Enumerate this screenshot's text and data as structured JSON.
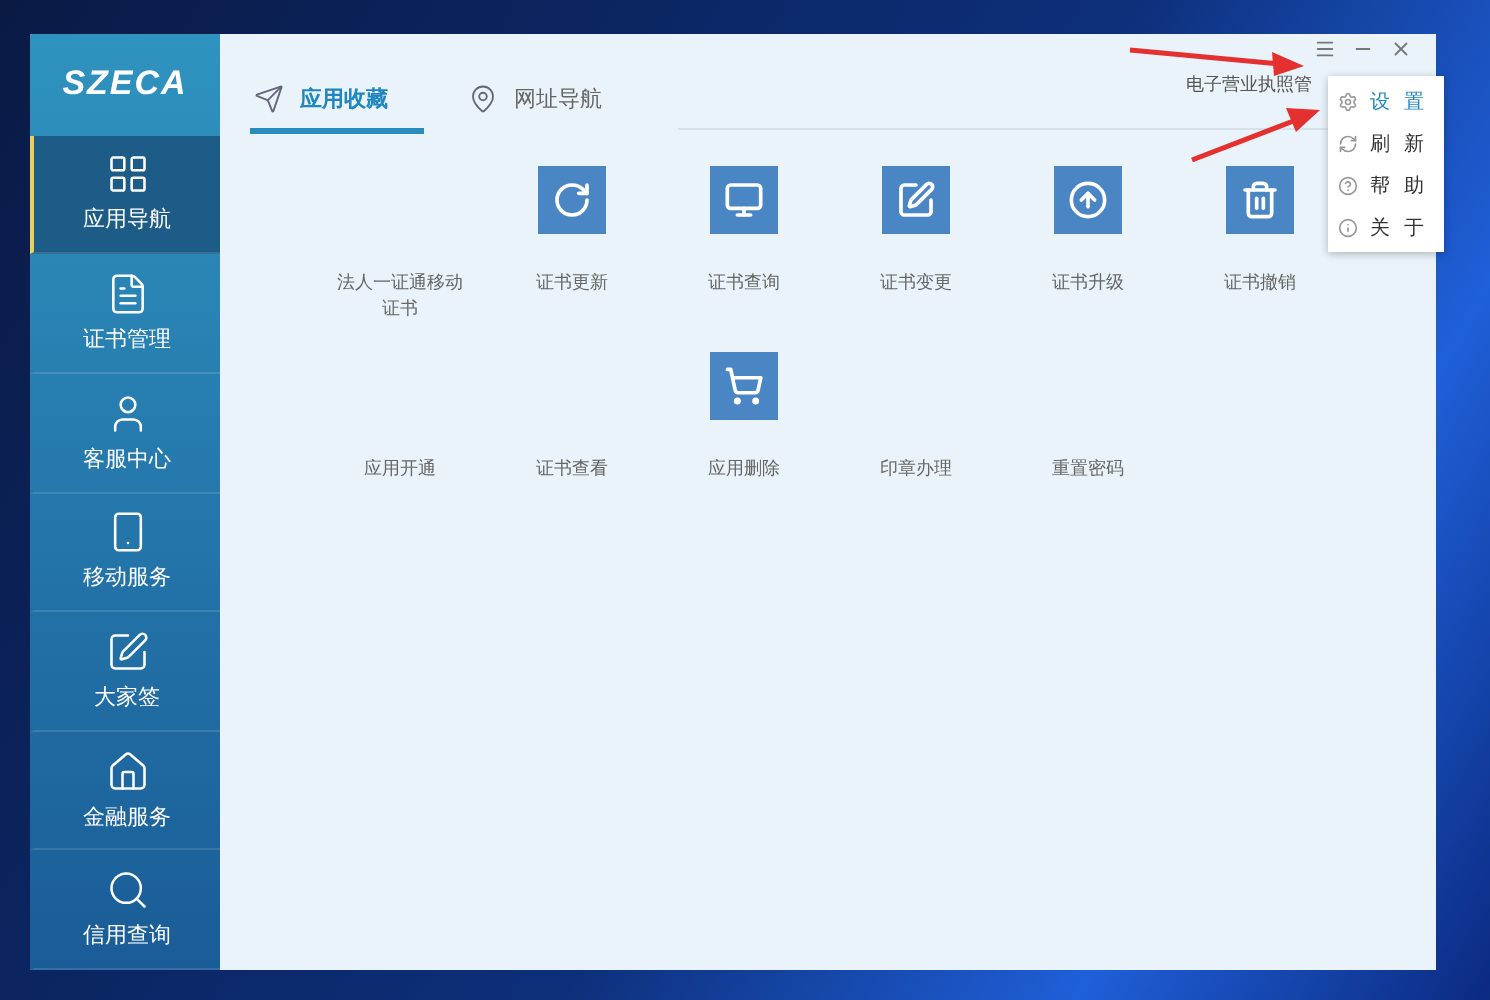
{
  "logo": "SZECA",
  "sidebar": {
    "items": [
      {
        "label": "应用导航",
        "selected": true
      },
      {
        "label": "证书管理",
        "selected": false
      },
      {
        "label": "客服中心",
        "selected": false
      },
      {
        "label": "移动服务",
        "selected": false
      },
      {
        "label": "大家签",
        "selected": false
      },
      {
        "label": "金融服务",
        "selected": false
      },
      {
        "label": "信用查询",
        "selected": false
      }
    ]
  },
  "tabs": [
    {
      "label": "应用收藏",
      "selected": true
    },
    {
      "label": "网址导航",
      "selected": false
    }
  ],
  "header_text": "电子营业执照管",
  "app_rows": [
    [
      {
        "label": "法人一证通移动证书",
        "kind": "plain"
      },
      {
        "label": "证书更新",
        "kind": "refresh"
      },
      {
        "label": "证书查询",
        "kind": "query"
      },
      {
        "label": "证书变更",
        "kind": "edit"
      },
      {
        "label": "证书升级",
        "kind": "upgrade"
      },
      {
        "label": "证书撤销",
        "kind": "trash"
      }
    ],
    [
      {
        "label": "应用开通",
        "kind": "plain"
      },
      {
        "label": "证书查看",
        "kind": "plain"
      },
      {
        "label": "应用删除",
        "kind": "cart"
      },
      {
        "label": "印章办理",
        "kind": "plain"
      },
      {
        "label": "重置密码",
        "kind": "plain"
      }
    ]
  ],
  "menu": {
    "items": [
      {
        "label": "设置",
        "selected": true
      },
      {
        "label": "刷新",
        "selected": false
      },
      {
        "label": "帮助",
        "selected": false
      },
      {
        "label": "关于",
        "selected": false
      }
    ]
  }
}
